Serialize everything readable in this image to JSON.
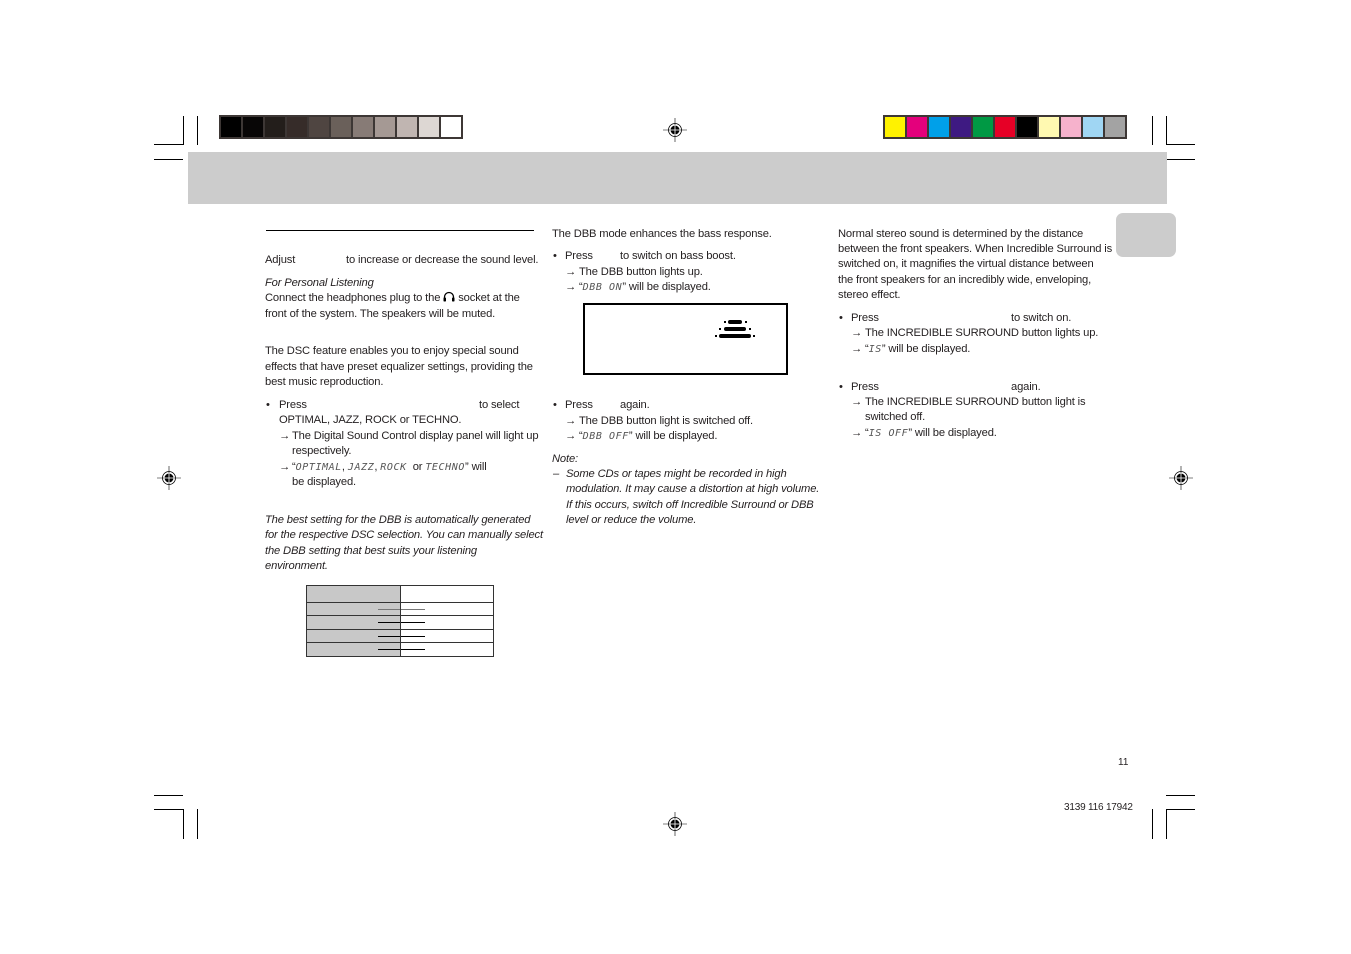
{
  "print_marks": {
    "grayscale_swatches": [
      "#000000",
      "#080606",
      "#231e1b",
      "#362c29",
      "#4f4541",
      "#6a605a",
      "#877b76",
      "#a59994",
      "#c0b5b1",
      "#ddd7d3",
      "#ffffff"
    ],
    "color_swatches": [
      "#fff200",
      "#e4007c",
      "#00a0e9",
      "#3e1a82",
      "#009944",
      "#e60026",
      "#000000",
      "#fff9b1",
      "#f6b2cc",
      "#a0d6f3",
      "#a3a3a3"
    ]
  },
  "column1": {
    "volume": {
      "adjust_prefix": "Adjust",
      "adjust_suffix": "to increase or decrease the sound level.",
      "personal_listening_heading": "For Personal Listening",
      "personal_line1_a": "Connect the headphones plug to the",
      "personal_line1_b": "socket at the",
      "personal_line2": "front of the system. The speakers will be muted."
    },
    "dsc": {
      "intro_line1": "The DSC feature enables you to enjoy special sound",
      "intro_line2": "effects that have preset equalizer settings, providing the",
      "intro_line3": "best music reproduction.",
      "press": "Press",
      "to_select": "to select",
      "options_line": "OPTIMAL, JAZZ, ROCK or TECHNO.",
      "result1_line1": "The Digital Sound Control display panel will light up",
      "result1_line2": "respectively.",
      "display_optimal": "OPTIMAL",
      "display_jazz": "JAZZ",
      "display_rock": "ROCK",
      "display_techno": "TECHNO",
      "or_word": "or",
      "will": "will",
      "be_displayed": "be displayed."
    },
    "dbb_note": {
      "line1": "The best setting for the DBB is automatically generated",
      "line2": "for the respective DSC selection. You can manually select",
      "line3": "the DBB setting that best suits your listening",
      "line4": "environment."
    },
    "dsc_dbb_table": {
      "rows": 5
    }
  },
  "column2": {
    "intro": "The DBB mode enhances the bass response.",
    "press": "Press",
    "switch_on": "to switch on bass boost.",
    "result_lights": "The DBB button lights up.",
    "display_on": "DBB ON",
    "will_be_displayed": "will be displayed.",
    "press_again": "again.",
    "result_off": "The DBB button light is switched off.",
    "display_off": "DBB OFF",
    "note_label": "Note:",
    "note_line1": "Some CDs or tapes might be recorded in high",
    "note_line2": "modulation. It may cause a distortion at high volume.",
    "note_line3": "If this occurs, switch off Incredible Surround or DBB",
    "note_line4": "level or reduce the volume."
  },
  "column3": {
    "intro_line1": "Normal stereo sound is determined by the distance",
    "intro_line2": "between the front speakers. When Incredible Surround is",
    "intro_line3": "switched on, it magnifies the virtual distance between",
    "intro_line4": "the front speakers for an incredibly wide, enveloping,",
    "intro_line5": "stereo effect.",
    "press": "Press",
    "to_switch_on": "to switch on.",
    "result_lights": "The INCREDIBLE SURROUND button lights up.",
    "display_is": "IS",
    "will_be_displayed": "will be displayed.",
    "again": "again.",
    "result_off_line1": "The INCREDIBLE SURROUND button light is",
    "result_off_line2": "switched off.",
    "display_is_off": "IS OFF"
  },
  "footer": {
    "page_number": "11",
    "doc_code": "3139 116 17942"
  },
  "glyphs": {
    "bullet": "•",
    "arrow": "→",
    "dash": "–",
    "open_quote": "“",
    "close_quote": "”",
    "comma": ","
  }
}
